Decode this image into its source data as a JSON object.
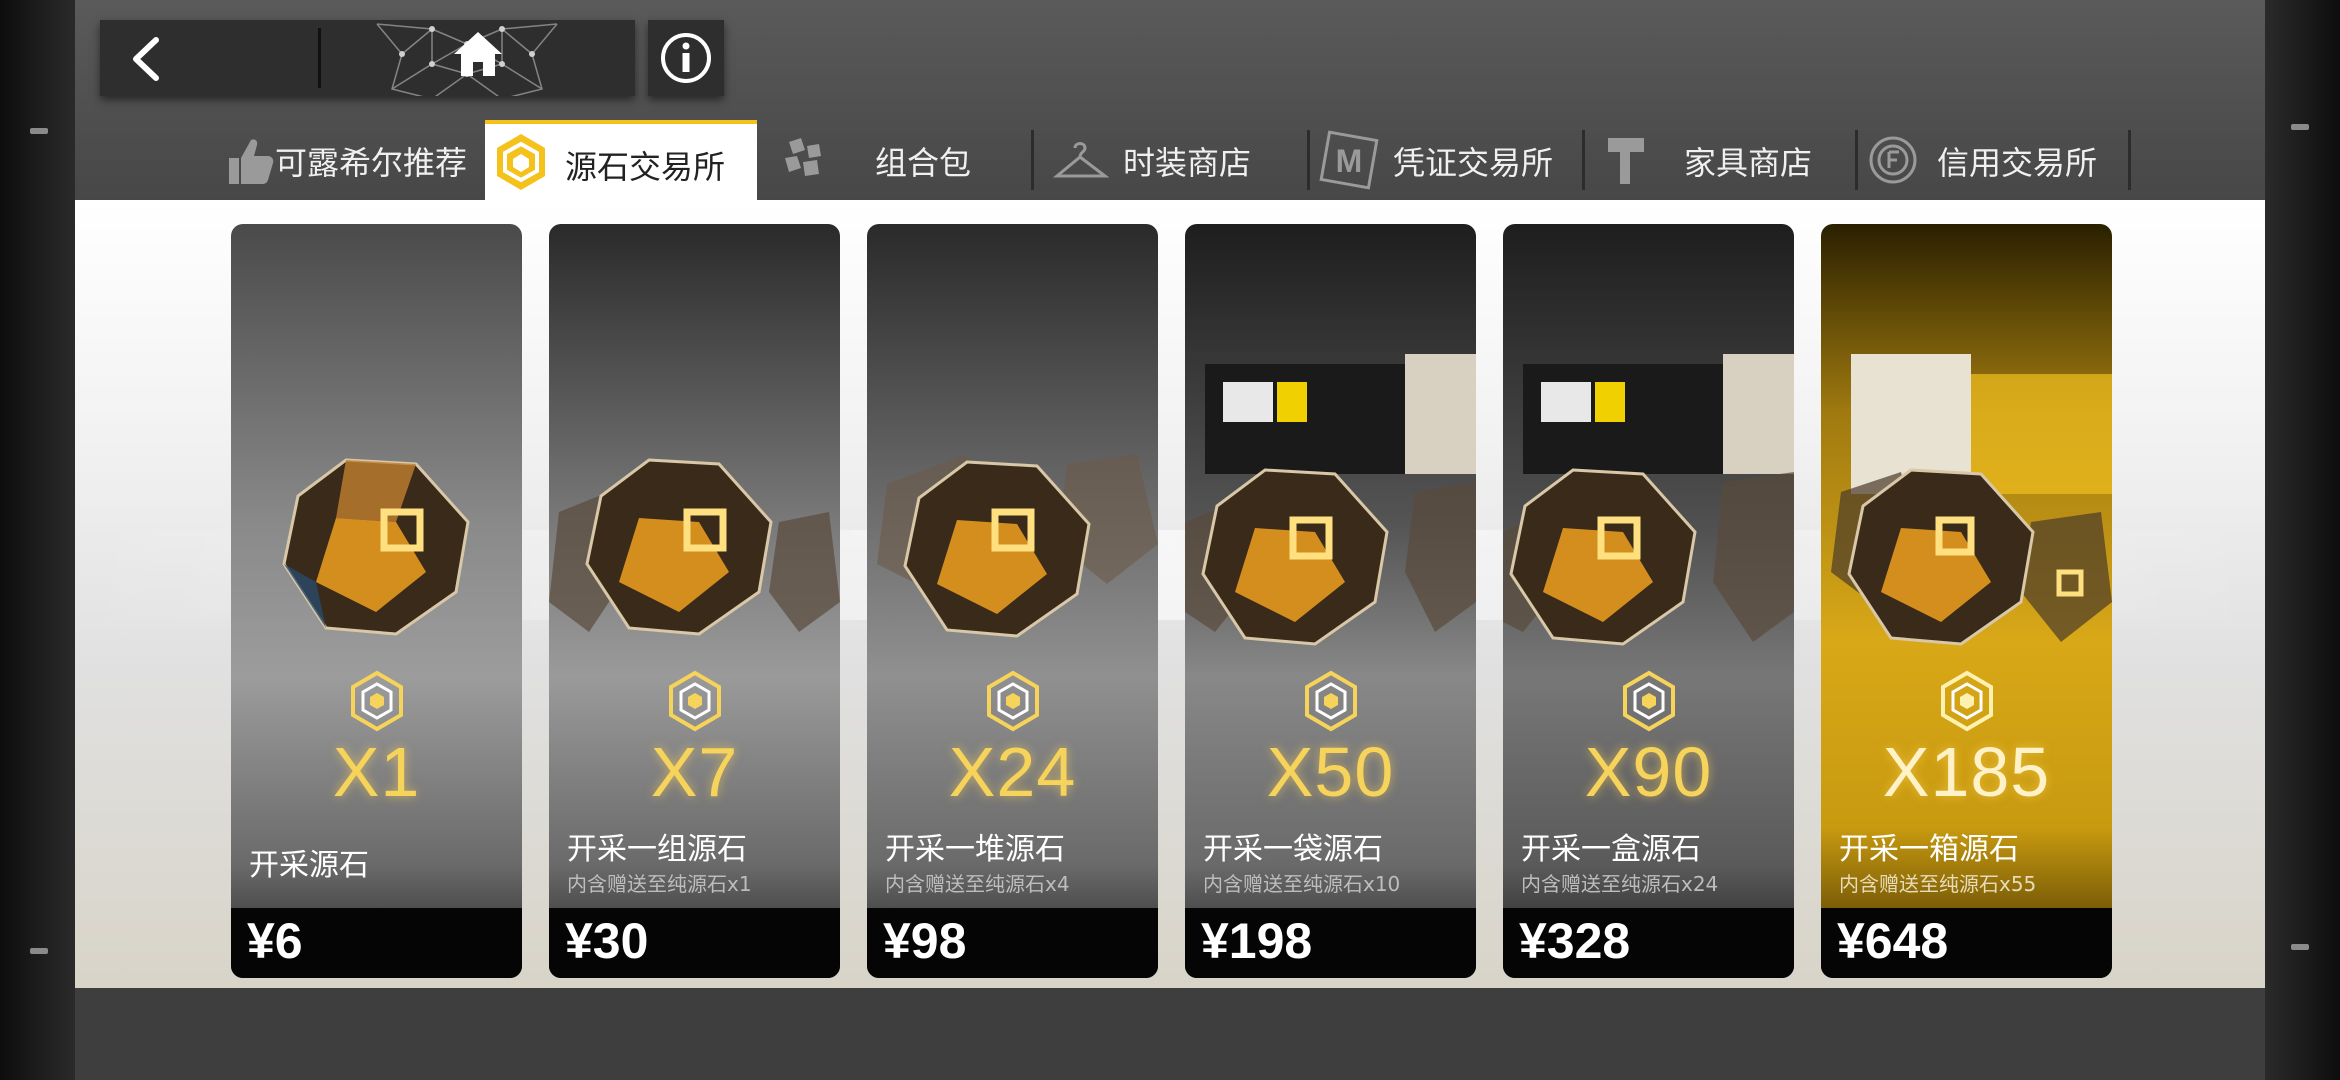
{
  "nav": {
    "back_icon": "chevron-left-icon",
    "home_icon": "home-icon",
    "info_icon": "info-icon"
  },
  "tabs": [
    {
      "label": "可露希尔推荐",
      "icon": "thumbs-up-icon",
      "active": false
    },
    {
      "label": "源石交易所",
      "icon": "originite-icon",
      "active": true
    },
    {
      "label": "组合包",
      "icon": "cubes-icon",
      "active": false
    },
    {
      "label": "时装商店",
      "icon": "hanger-icon",
      "active": false
    },
    {
      "label": "凭证交易所",
      "icon": "certificate-icon",
      "active": false
    },
    {
      "label": "家具商店",
      "icon": "hammer-icon",
      "active": false
    },
    {
      "label": "信用交易所",
      "icon": "credit-icon",
      "active": false
    }
  ],
  "colors": {
    "accent_gold": "#f4c21a",
    "qty_gold": "#f6d35a",
    "price_bar": "#050505"
  },
  "products": [
    {
      "qty": "X1",
      "name": "开采源石",
      "sub": "",
      "price": "¥6"
    },
    {
      "qty": "X7",
      "name": "开采一组源石",
      "sub": "内含赠送至纯源石x1",
      "price": "¥30"
    },
    {
      "qty": "X24",
      "name": "开采一堆源石",
      "sub": "内含赠送至纯源石x4",
      "price": "¥98"
    },
    {
      "qty": "X50",
      "name": "开采一袋源石",
      "sub": "内含赠送至纯源石x10",
      "price": "¥198"
    },
    {
      "qty": "X90",
      "name": "开采一盒源石",
      "sub": "内含赠送至纯源石x24",
      "price": "¥328"
    },
    {
      "qty": "X185",
      "name": "开采一箱源石",
      "sub": "内含赠送至纯源石x55",
      "price": "¥648"
    }
  ]
}
